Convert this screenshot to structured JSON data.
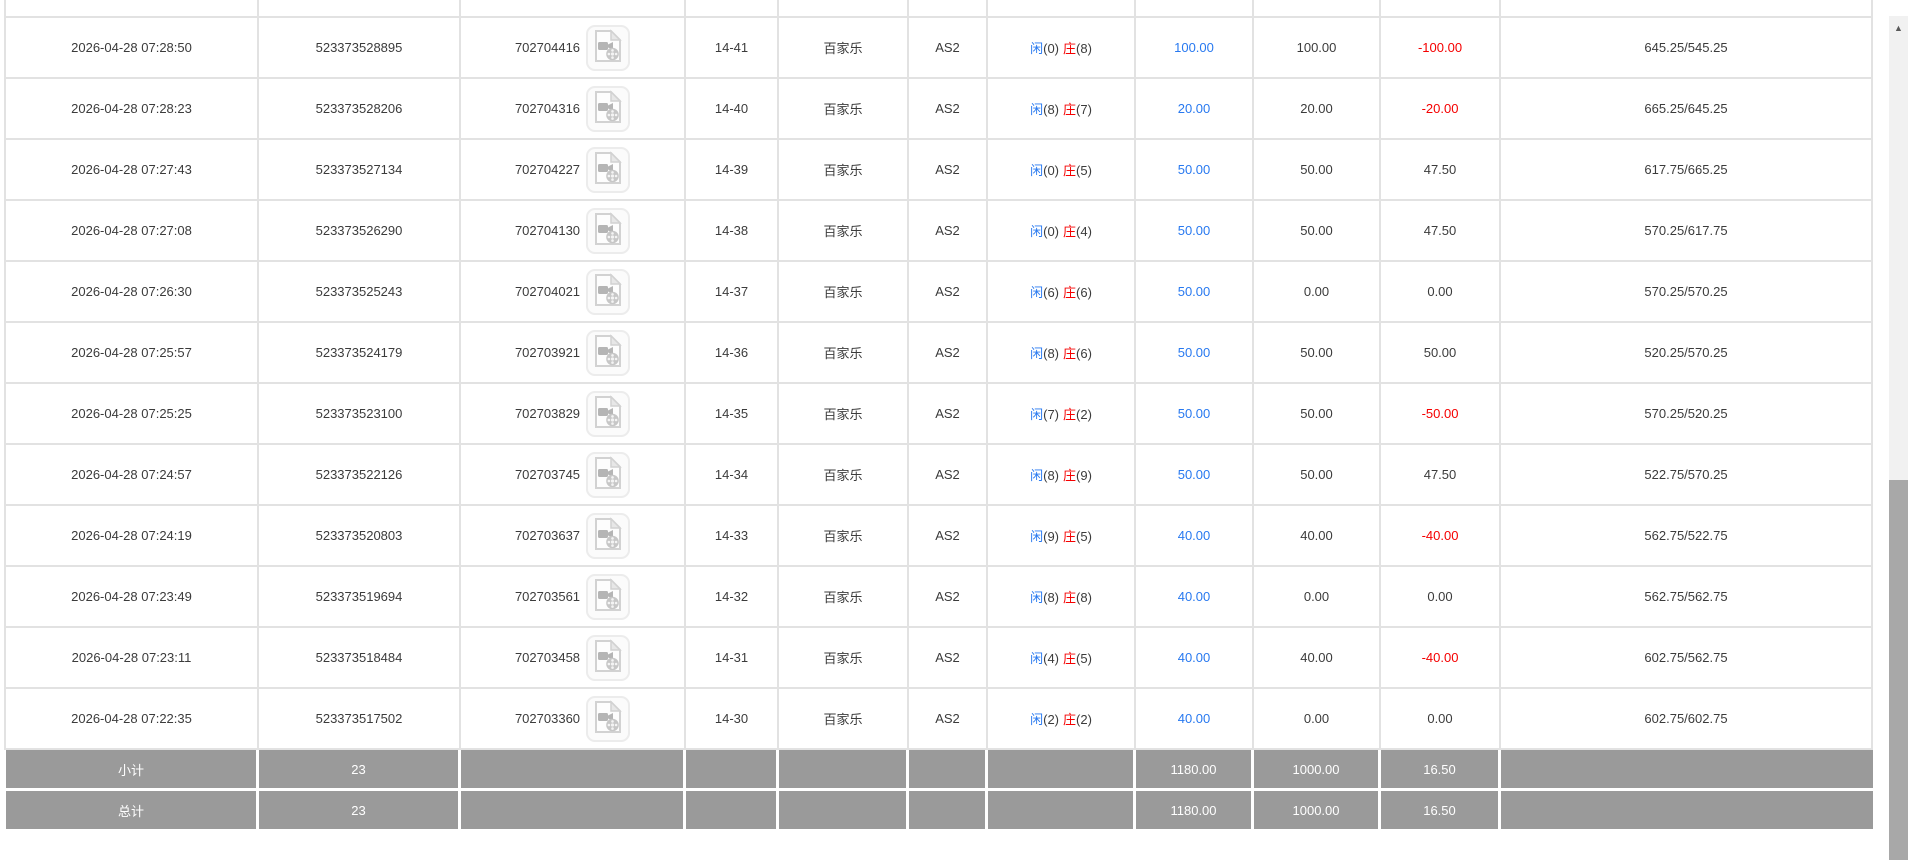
{
  "colors": {
    "accent_blue": "#2879f0",
    "loss_red": "#f50000",
    "footer_gray": "#9a9a9a",
    "border_gray": "#e2e2e2"
  },
  "icons": {
    "video_replay": "video-file-icon",
    "scroll_up_arrow": "▲"
  },
  "table": {
    "rows": [
      {
        "time": "2026-04-28 07:28:50",
        "order_id": "523373528895",
        "game_no": "702704416",
        "round": "14-41",
        "game": "百家乐",
        "table": "AS2",
        "player": "闲",
        "player_pts": "(0)",
        "banker": "庄",
        "banker_pts": "(8)",
        "bet": "100.00",
        "valid": "100.00",
        "win": "-100.00",
        "balance": "645.25/545.25"
      },
      {
        "time": "2026-04-28 07:28:23",
        "order_id": "523373528206",
        "game_no": "702704316",
        "round": "14-40",
        "game": "百家乐",
        "table": "AS2",
        "player": "闲",
        "player_pts": "(8)",
        "banker": "庄",
        "banker_pts": "(7)",
        "bet": "20.00",
        "valid": "20.00",
        "win": "-20.00",
        "balance": "665.25/645.25"
      },
      {
        "time": "2026-04-28 07:27:43",
        "order_id": "523373527134",
        "game_no": "702704227",
        "round": "14-39",
        "game": "百家乐",
        "table": "AS2",
        "player": "闲",
        "player_pts": "(0)",
        "banker": "庄",
        "banker_pts": "(5)",
        "bet": "50.00",
        "valid": "50.00",
        "win": "47.50",
        "balance": "617.75/665.25"
      },
      {
        "time": "2026-04-28 07:27:08",
        "order_id": "523373526290",
        "game_no": "702704130",
        "round": "14-38",
        "game": "百家乐",
        "table": "AS2",
        "player": "闲",
        "player_pts": "(0)",
        "banker": "庄",
        "banker_pts": "(4)",
        "bet": "50.00",
        "valid": "50.00",
        "win": "47.50",
        "balance": "570.25/617.75"
      },
      {
        "time": "2026-04-28 07:26:30",
        "order_id": "523373525243",
        "game_no": "702704021",
        "round": "14-37",
        "game": "百家乐",
        "table": "AS2",
        "player": "闲",
        "player_pts": "(6)",
        "banker": "庄",
        "banker_pts": "(6)",
        "bet": "50.00",
        "valid": "0.00",
        "win": "0.00",
        "balance": "570.25/570.25"
      },
      {
        "time": "2026-04-28 07:25:57",
        "order_id": "523373524179",
        "game_no": "702703921",
        "round": "14-36",
        "game": "百家乐",
        "table": "AS2",
        "player": "闲",
        "player_pts": "(8)",
        "banker": "庄",
        "banker_pts": "(6)",
        "bet": "50.00",
        "valid": "50.00",
        "win": "50.00",
        "balance": "520.25/570.25"
      },
      {
        "time": "2026-04-28 07:25:25",
        "order_id": "523373523100",
        "game_no": "702703829",
        "round": "14-35",
        "game": "百家乐",
        "table": "AS2",
        "player": "闲",
        "player_pts": "(7)",
        "banker": "庄",
        "banker_pts": "(2)",
        "bet": "50.00",
        "valid": "50.00",
        "win": "-50.00",
        "balance": "570.25/520.25"
      },
      {
        "time": "2026-04-28 07:24:57",
        "order_id": "523373522126",
        "game_no": "702703745",
        "round": "14-34",
        "game": "百家乐",
        "table": "AS2",
        "player": "闲",
        "player_pts": "(8)",
        "banker": "庄",
        "banker_pts": "(9)",
        "bet": "50.00",
        "valid": "50.00",
        "win": "47.50",
        "balance": "522.75/570.25"
      },
      {
        "time": "2026-04-28 07:24:19",
        "order_id": "523373520803",
        "game_no": "702703637",
        "round": "14-33",
        "game": "百家乐",
        "table": "AS2",
        "player": "闲",
        "player_pts": "(9)",
        "banker": "庄",
        "banker_pts": "(5)",
        "bet": "40.00",
        "valid": "40.00",
        "win": "-40.00",
        "balance": "562.75/522.75"
      },
      {
        "time": "2026-04-28 07:23:49",
        "order_id": "523373519694",
        "game_no": "702703561",
        "round": "14-32",
        "game": "百家乐",
        "table": "AS2",
        "player": "闲",
        "player_pts": "(8)",
        "banker": "庄",
        "banker_pts": "(8)",
        "bet": "40.00",
        "valid": "0.00",
        "win": "0.00",
        "balance": "562.75/562.75"
      },
      {
        "time": "2026-04-28 07:23:11",
        "order_id": "523373518484",
        "game_no": "702703458",
        "round": "14-31",
        "game": "百家乐",
        "table": "AS2",
        "player": "闲",
        "player_pts": "(4)",
        "banker": "庄",
        "banker_pts": "(5)",
        "bet": "40.00",
        "valid": "40.00",
        "win": "-40.00",
        "balance": "602.75/562.75"
      },
      {
        "time": "2026-04-28 07:22:35",
        "order_id": "523373517502",
        "game_no": "702703360",
        "round": "14-30",
        "game": "百家乐",
        "table": "AS2",
        "player": "闲",
        "player_pts": "(2)",
        "banker": "庄",
        "banker_pts": "(2)",
        "bet": "40.00",
        "valid": "0.00",
        "win": "0.00",
        "balance": "602.75/602.75"
      }
    ],
    "footer_rows": [
      {
        "label": "小计",
        "count": "23",
        "bet": "1180.00",
        "valid": "1000.00",
        "win": "16.50"
      },
      {
        "label": "总计",
        "count": "23",
        "bet": "1180.00",
        "valid": "1000.00",
        "win": "16.50"
      }
    ]
  }
}
